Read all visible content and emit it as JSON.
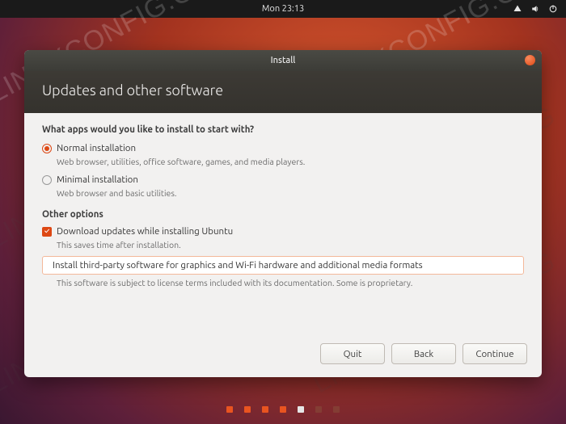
{
  "topbar": {
    "clock": "Mon 23:13"
  },
  "watermark": "LINUXCONFIG.ORG",
  "window": {
    "title": "Install",
    "header": "Updates and other software",
    "question": "What apps would you like to install to start with?",
    "options": {
      "normal": {
        "label": "Normal installation",
        "desc": "Web browser, utilities, office software, games, and media players.",
        "selected": true
      },
      "minimal": {
        "label": "Minimal installation",
        "desc": "Web browser and basic utilities.",
        "selected": false
      }
    },
    "other_heading": "Other options",
    "other": {
      "download": {
        "label": "Download updates while installing Ubuntu",
        "desc": "This saves time after installation.",
        "checked": true
      },
      "thirdparty": {
        "label": "Install third-party software for graphics and Wi-Fi hardware and additional media formats",
        "desc": "This software is subject to license terms included with its documentation. Some is proprietary.",
        "checked": true
      }
    },
    "buttons": {
      "quit": "Quit",
      "back": "Back",
      "continue": "Continue"
    }
  },
  "steps": {
    "total": 7,
    "done": 4,
    "current": 5
  }
}
